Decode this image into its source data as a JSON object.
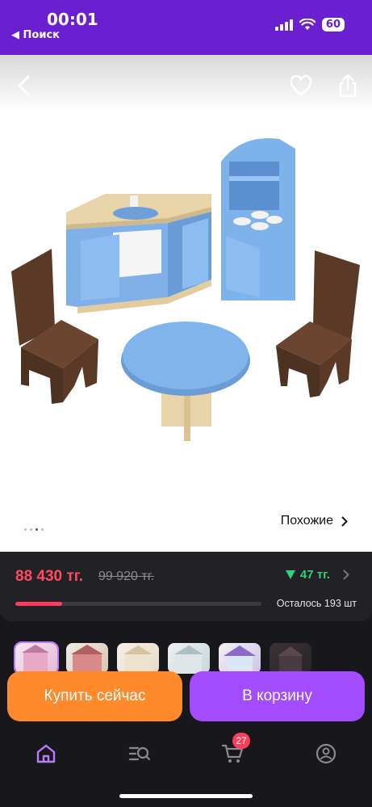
{
  "status": {
    "time": "00:01",
    "back_label": "◀ Поиск",
    "battery": "60"
  },
  "gallery": {
    "similar_label": "Похожие",
    "dot_count": 4,
    "active_dot": 2
  },
  "price": {
    "current": "88 430 тг.",
    "old": "99 920 тг.",
    "bonus": "47 тг."
  },
  "stock": {
    "text": "Осталось 193 шт",
    "progress_fraction": 0.19
  },
  "actions": {
    "buy_now": "Купить сейчас",
    "add_to_cart": "В корзину"
  },
  "tabbar": {
    "cart_count": "27"
  },
  "icons": [
    "back-arrow-icon",
    "heart-icon",
    "share-icon",
    "chevron-right-icon",
    "triangle-down-icon",
    "home-icon",
    "catalog-search-icon",
    "cart-icon",
    "profile-icon"
  ],
  "colors": {
    "brand": "#6a1fd0",
    "price": "#ff4a62",
    "bonus": "#2fd17a",
    "buy_now": "#ff8a2b",
    "add_to_cart": "#a24bff"
  }
}
